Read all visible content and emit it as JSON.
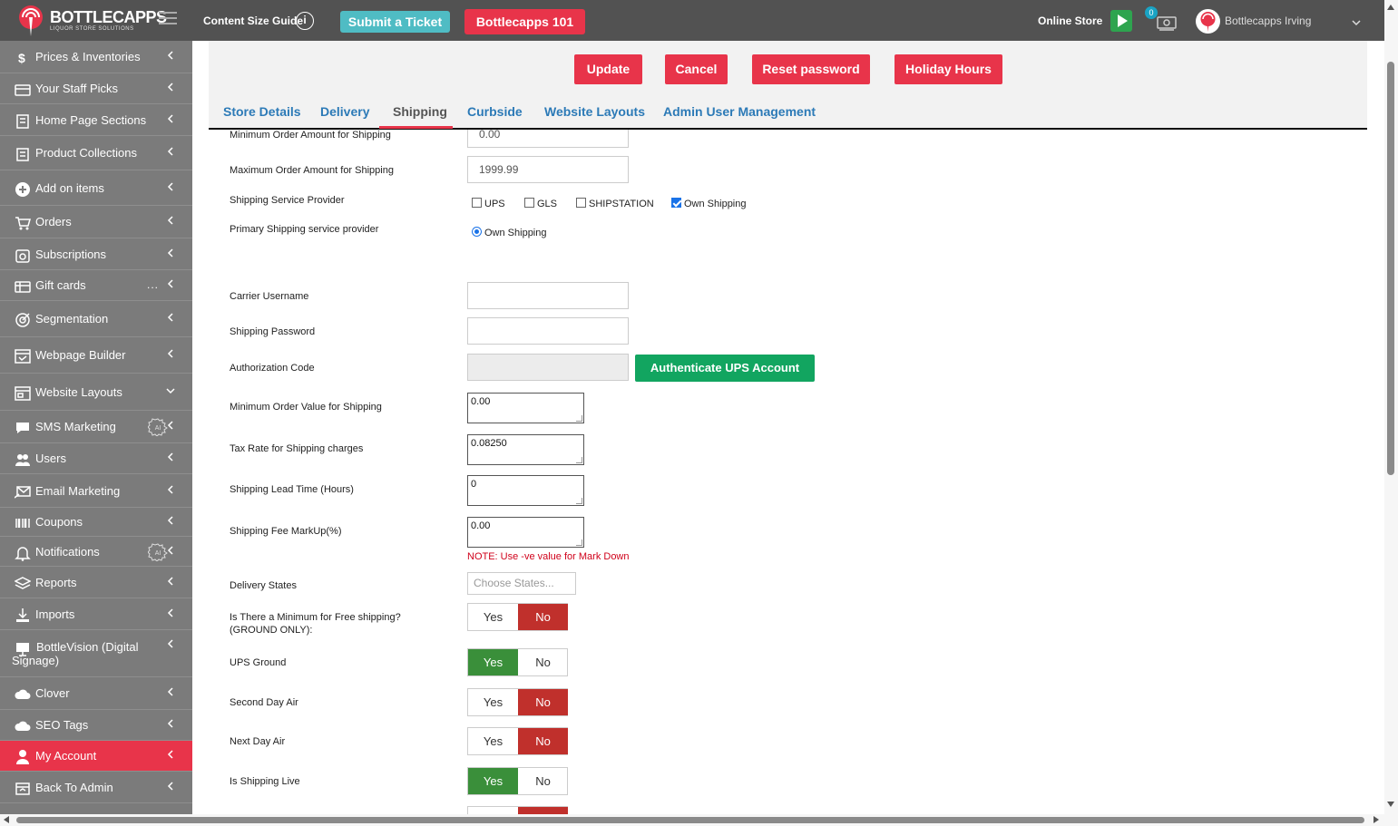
{
  "header": {
    "brand": "BOTTLECAPPS",
    "brand_tagline": "LIQUOR STORE SOLUTIONS",
    "content_size_guide": "Content Size Guide",
    "info_glyph": "i",
    "submit_ticket": "Submit a Ticket",
    "bottlecapps_101": "Bottlecapps 101",
    "online_store": "Online Store",
    "notification_count": "0",
    "user_name": "Bottlecapps Irving"
  },
  "sidebar": {
    "items": [
      {
        "label": "Prices & Inventories",
        "icon": "dollar-icon"
      },
      {
        "label": "Your Staff Picks",
        "icon": "card-icon"
      },
      {
        "label": "Home Page Sections",
        "icon": "building-icon"
      },
      {
        "label": "Product Collections",
        "icon": "collection-icon"
      },
      {
        "label": "Add on items",
        "icon": "plus-circle-icon"
      },
      {
        "label": "Orders",
        "icon": "cart-icon"
      },
      {
        "label": "Subscriptions",
        "icon": "subscription-icon"
      },
      {
        "label": "Gift cards",
        "icon": "gift-card-icon",
        "extra": "..."
      },
      {
        "label": "Segmentation",
        "icon": "target-icon"
      },
      {
        "label": "Webpage Builder",
        "icon": "builder-icon"
      },
      {
        "label": "Website Layouts",
        "icon": "layout-icon"
      },
      {
        "label": "SMS Marketing",
        "icon": "chat-icon"
      },
      {
        "label": "Users",
        "icon": "users-icon"
      },
      {
        "label": "Email Marketing",
        "icon": "email-icon"
      },
      {
        "label": "Coupons",
        "icon": "barcode-icon"
      },
      {
        "label": "Notifications",
        "icon": "bell-icon"
      },
      {
        "label": "Reports",
        "icon": "layers-icon"
      },
      {
        "label": "Imports",
        "icon": "import-icon"
      },
      {
        "label": "BottleVision (Digital Signage)",
        "icon": "monitor-icon"
      },
      {
        "label": "Clover",
        "icon": "cloud-icon"
      },
      {
        "label": "SEO Tags",
        "icon": "cloud-icon"
      },
      {
        "label": "My Account",
        "icon": "user-icon"
      },
      {
        "label": "Back To Admin",
        "icon": "admin-icon"
      }
    ],
    "ai_badge": "AI"
  },
  "actions": {
    "update": "Update",
    "cancel": "Cancel",
    "reset_password": "Reset password",
    "holiday_hours": "Holiday Hours"
  },
  "tabs": [
    "Store Details",
    "Delivery",
    "Shipping",
    "Curbside",
    "Website Layouts",
    "Admin User Management"
  ],
  "form": {
    "min_order_label": "Minimum Order Amount for Shipping",
    "min_order_value": "0.00",
    "max_order_label": "Maximum Order Amount for Shipping",
    "max_order_value": "1999.99",
    "provider_label": "Shipping Service Provider",
    "providers": {
      "ups": "UPS",
      "gls": "GLS",
      "shipstation": "SHIPSTATION",
      "own": "Own Shipping"
    },
    "primary_label": "Primary Shipping service provider",
    "primary_value": "Own Shipping",
    "carrier_username_label": "Carrier Username",
    "carrier_username_value": "",
    "shipping_password_label": "Shipping Password",
    "shipping_password_value": "",
    "auth_code_label": "Authorization Code",
    "auth_code_value": "",
    "authenticate_button": "Authenticate UPS Account",
    "min_order_value_label": "Minimum Order Value for Shipping",
    "min_order_value_value": "0.00",
    "tax_rate_label": "Tax Rate for Shipping charges",
    "tax_rate_value": "0.08250",
    "lead_time_label": "Shipping Lead Time (Hours)",
    "lead_time_value": "0",
    "markup_label": "Shipping Fee MarkUp(%)",
    "markup_value": "0.00",
    "markup_note": "NOTE: Use -ve value for Mark Down",
    "delivery_states_label": "Delivery States",
    "delivery_states_placeholder": "Choose States...",
    "free_shipping_label_1": "Is There a Minimum for Free shipping?",
    "free_shipping_label_2": "(GROUND ONLY):",
    "ups_ground_label": "UPS Ground",
    "second_day_label": "Second Day Air",
    "next_day_label": "Next Day Air",
    "shipping_live_label": "Is Shipping Live",
    "yes": "Yes",
    "no": "No"
  },
  "colors": {
    "topbar": "#525252",
    "sidebar": "#7b7b7b",
    "accent": "#e8344a",
    "teal": "#4fbcc4",
    "green": "#12a560",
    "toggle_yes": "#3a8f3a",
    "toggle_no": "#c0302c",
    "tab_link": "#2c7ab7"
  }
}
